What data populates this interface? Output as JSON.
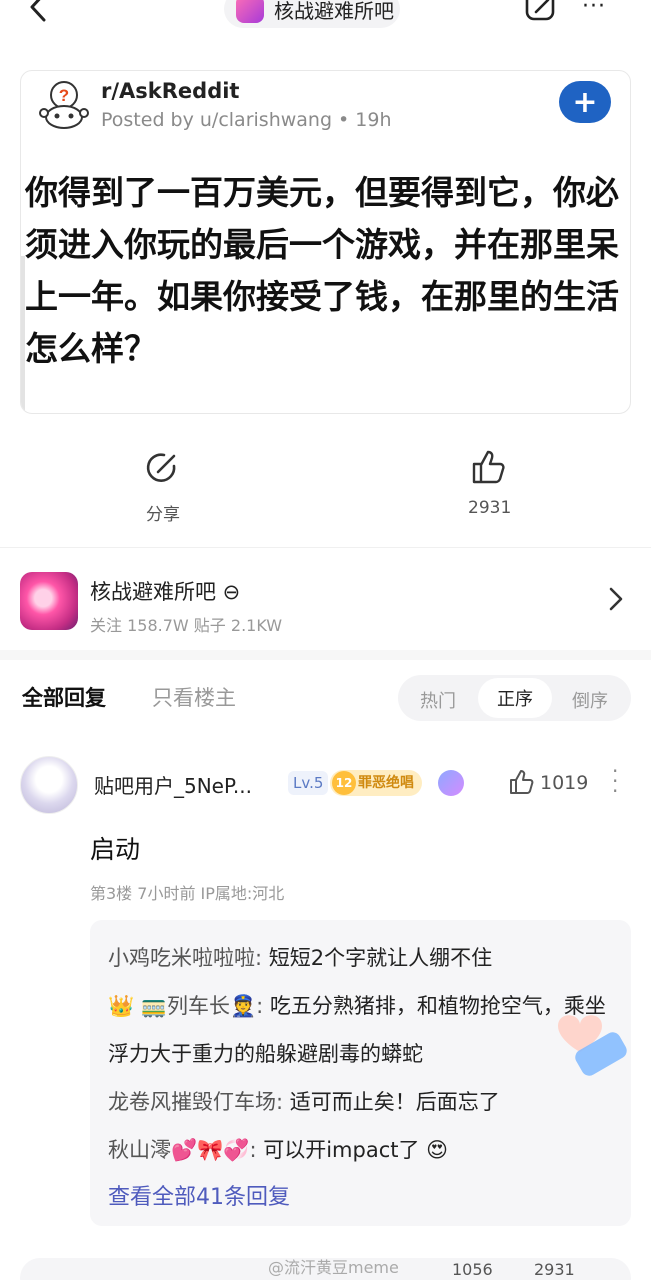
{
  "topbar": {
    "forum_title": "核战避难所吧",
    "more": "···"
  },
  "post": {
    "subreddit": "r/AskReddit",
    "posted_by": "Posted by u/clarishwang • 19h",
    "join": "+",
    "title": "你得到了一百万美元，但要得到它，你必须进入你玩的最后一个游戏，并在那里呆上一年。如果你接受了钱，在那里的生活怎么样？"
  },
  "actions": {
    "share_label": "分享",
    "like_count": "2931"
  },
  "forum": {
    "name": "核战避难所吧 ⊖",
    "stats": "关注 158.7W   贴子 2.1KW"
  },
  "tabs": {
    "all": "全部回复",
    "op_only": "只看楼主",
    "sort": {
      "hot": "热门",
      "asc": "正序",
      "desc": "倒序"
    }
  },
  "comment": {
    "user": "贴吧用户_5NeP...",
    "level": "Lv.5",
    "badge_num": "12",
    "badge_text": "罪恶绝唱",
    "likes": "1019",
    "text": "启动",
    "meta": "第3楼   7小时前   IP属地:河北",
    "replies": [
      {
        "name": "小鸡吃米啦啦啦:",
        "text": " 短短2个字就让人绷不住"
      },
      {
        "name": "👑 🚃列车长👮:",
        "text": " 吃五分熟猪排，和植物抢空气，乘坐浮力大于重力的船躲避剧毒的蟒蛇"
      },
      {
        "name": "龙卷风摧毁仃车场:",
        "text": " 适可而止矣！后面忘了"
      },
      {
        "name": "秋山澪💕🎀💞:",
        "text": " 可以开impact了 😍"
      }
    ],
    "view_all": "查看全部41条回复"
  },
  "bottom": {
    "watermark": "@流汗黄豆meme",
    "count1": "1056",
    "count2": "2931"
  },
  "colors": {
    "accent_blue": "#1f63c3",
    "link_purple": "#4f5bbd",
    "badge_gold": "#ffbf3c"
  }
}
